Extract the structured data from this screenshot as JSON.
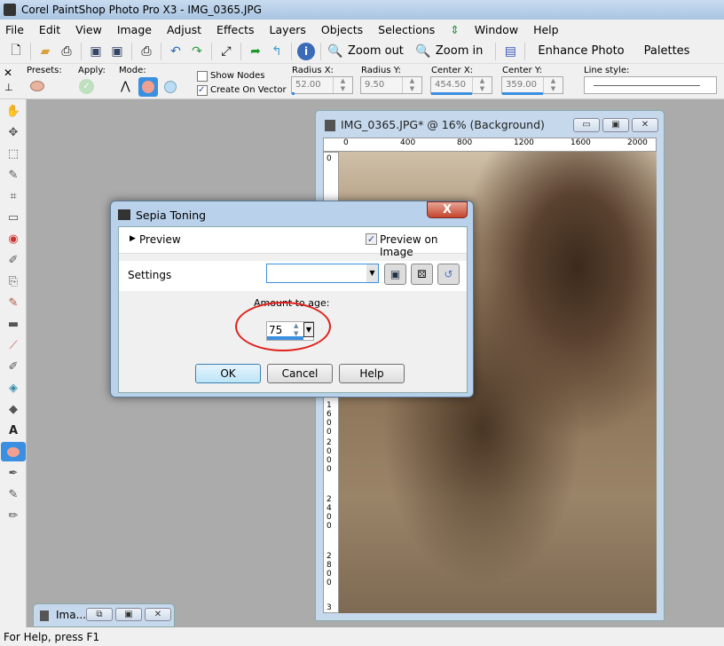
{
  "app": {
    "title": "Corel PaintShop Photo Pro X3 - IMG_0365.JPG"
  },
  "menu": [
    "File",
    "Edit",
    "View",
    "Image",
    "Adjust",
    "Effects",
    "Layers",
    "Objects",
    "Selections",
    "Window",
    "Help"
  ],
  "toolbar": {
    "zoom_out": "Zoom out",
    "zoom_in": "Zoom in",
    "enhance": "Enhance Photo",
    "palettes": "Palettes"
  },
  "options": {
    "presets": "Presets:",
    "apply": "Apply:",
    "mode": "Mode:",
    "show_nodes": "Show Nodes",
    "show_nodes_checked": false,
    "create_on_vector": "Create On Vector",
    "create_on_vector_checked": true,
    "radius_x_label": "Radius X:",
    "radius_x": "52.00",
    "radius_y_label": "Radius Y:",
    "radius_y": "9.50",
    "center_x_label": "Center X:",
    "center_x": "454.50",
    "center_y_label": "Center Y:",
    "center_y": "359.00",
    "line_style": "Line style:"
  },
  "image_window": {
    "title": "IMG_0365.JPG* @  16% (Background)",
    "hruler": [
      "0",
      "400",
      "800",
      "1200",
      "1600",
      "2000"
    ],
    "vruler": [
      "0",
      "1600",
      "2000",
      "2400",
      "2800",
      "3"
    ]
  },
  "dialog": {
    "title": "Sepia Toning",
    "close": "X",
    "preview": "Preview",
    "preview_on_image": "Preview on Image",
    "preview_on_image_checked": true,
    "settings": "Settings",
    "settings_value": "",
    "amount_label": "Amount to age:",
    "amount": "75",
    "ok": "OK",
    "cancel": "Cancel",
    "help": "Help",
    "annotation_color": "#e0201a"
  },
  "minimized_window": {
    "title": "Ima..."
  },
  "status": "For Help, press F1"
}
